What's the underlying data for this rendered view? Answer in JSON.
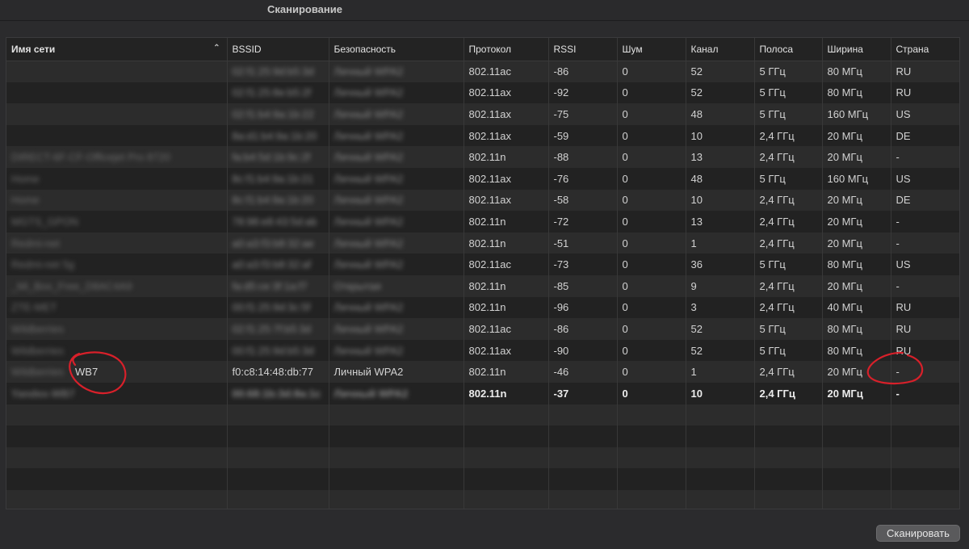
{
  "window": {
    "title": "Сканирование"
  },
  "table": {
    "columns": [
      "Имя сети",
      "BSSID",
      "Безопасность",
      "Протокол",
      "RSSI",
      "Шум",
      "Канал",
      "Полоса",
      "Ширина",
      "Страна"
    ],
    "sorted_column": "Имя сети",
    "sort_direction": "ascending",
    "rows": [
      {
        "ssid": "",
        "bssid": "02:f1:25:9d:b5:3d",
        "security": "Личный WPA2",
        "protocol": "802.11ac",
        "rssi": "-86",
        "noise": "0",
        "channel": "52",
        "band": "5 ГГц",
        "width": "80 МГц",
        "country": "RU"
      },
      {
        "ssid": "",
        "bssid": "02:f1:25:8e:b5:2f",
        "security": "Личный WPA2",
        "protocol": "802.11ax",
        "rssi": "-92",
        "noise": "0",
        "channel": "52",
        "band": "5 ГГц",
        "width": "80 МГц",
        "country": "RU"
      },
      {
        "ssid": "",
        "bssid": "02:f1:b4:9a:1b:22",
        "security": "Личный WPA2",
        "protocol": "802.11ax",
        "rssi": "-75",
        "noise": "0",
        "channel": "48",
        "band": "5 ГГц",
        "width": "160 МГц",
        "country": "US"
      },
      {
        "ssid": "",
        "bssid": "8a:d1:b4:9a:1b:20",
        "security": "Личный WPA2",
        "protocol": "802.11ax",
        "rssi": "-59",
        "noise": "0",
        "channel": "10",
        "band": "2,4 ГГц",
        "width": "20 МГц",
        "country": "DE"
      },
      {
        "ssid": "DIRECT-6F-CF-Officejet Pro 8720",
        "bssid": "fa:b4:5d:1b:9c:2f",
        "security": "Личный WPA2",
        "protocol": "802.11n",
        "rssi": "-88",
        "noise": "0",
        "channel": "13",
        "band": "2,4 ГГц",
        "width": "20 МГц",
        "country": "-"
      },
      {
        "ssid": "Home",
        "bssid": "8c:f1:b4:9a:1b:21",
        "security": "Личный WPA2",
        "protocol": "802.11ax",
        "rssi": "-76",
        "noise": "0",
        "channel": "48",
        "band": "5 ГГц",
        "width": "160 МГц",
        "country": "US"
      },
      {
        "ssid": "Home",
        "bssid": "8c:f1:b4:9a:1b:20",
        "security": "Личный WPA2",
        "protocol": "802.11ax",
        "rssi": "-58",
        "noise": "0",
        "channel": "10",
        "band": "2,4 ГГц",
        "width": "20 МГц",
        "country": "DE"
      },
      {
        "ssid": "MGTS_GPON",
        "bssid": "78:98:e8:43:5d:ab",
        "security": "Личный WPA2",
        "protocol": "802.11n",
        "rssi": "-72",
        "noise": "0",
        "channel": "13",
        "band": "2,4 ГГц",
        "width": "20 МГц",
        "country": "-"
      },
      {
        "ssid": "Redmi-net",
        "bssid": "a0:a3:f3:b8:32:ae",
        "security": "Личный WPA2",
        "protocol": "802.11n",
        "rssi": "-51",
        "noise": "0",
        "channel": "1",
        "band": "2,4 ГГц",
        "width": "20 МГц",
        "country": "-"
      },
      {
        "ssid": "Redmi-net 5g",
        "bssid": "a0:a3:f3:b8:32:af",
        "security": "Личный WPA2",
        "protocol": "802.11ac",
        "rssi": "-73",
        "noise": "0",
        "channel": "36",
        "band": "5 ГГц",
        "width": "80 МГц",
        "country": "US"
      },
      {
        "ssid": "_Mi_Box_Free_D8AC4A9",
        "bssid": "fa:d5:ce:3f:1a:f7",
        "security": "Открытая",
        "protocol": "802.11n",
        "rssi": "-85",
        "noise": "0",
        "channel": "9",
        "band": "2,4 ГГц",
        "width": "20 МГц",
        "country": "-"
      },
      {
        "ssid": "ZTE-MET",
        "bssid": "00:f1:25:9d:3c:5f",
        "security": "Личный WPA2",
        "protocol": "802.11n",
        "rssi": "-96",
        "noise": "0",
        "channel": "3",
        "band": "2,4 ГГц",
        "width": "40 МГц",
        "country": "RU"
      },
      {
        "ssid": "Wildberries",
        "bssid": "02:f1:25:7f:b5:3d",
        "security": "Личный WPA2",
        "protocol": "802.11ac",
        "rssi": "-86",
        "noise": "0",
        "channel": "52",
        "band": "5 ГГц",
        "width": "80 МГц",
        "country": "RU"
      },
      {
        "ssid": "Wildberries",
        "bssid": "00:f1:25:9d:b5:3d",
        "security": "Личный WPA2",
        "protocol": "802.11ax",
        "rssi": "-90",
        "noise": "0",
        "channel": "52",
        "band": "5 ГГц",
        "width": "80 МГц",
        "country": "RU"
      },
      {
        "ssid": "WB7",
        "ssid_prefix": "Wildberries",
        "bssid": "f0:c8:14:48:db:77",
        "security": "Личный WPA2",
        "protocol": "802.11n",
        "rssi": "-46",
        "noise": "0",
        "channel": "1",
        "band": "2,4 ГГц",
        "width": "20 МГц",
        "country": "-"
      },
      {
        "ssid": "Yandex-WB7",
        "bssid": "00:68:1b:3d:8a:1c",
        "security": "Личный WPA2",
        "protocol": "802.11n",
        "rssi": "-37",
        "noise": "0",
        "channel": "10",
        "band": "2,4 ГГц",
        "width": "20 МГц",
        "country": "-"
      }
    ],
    "empty_rows": 5
  },
  "scan_button_label": "Сканировать",
  "annotation_color": "#d8202a"
}
